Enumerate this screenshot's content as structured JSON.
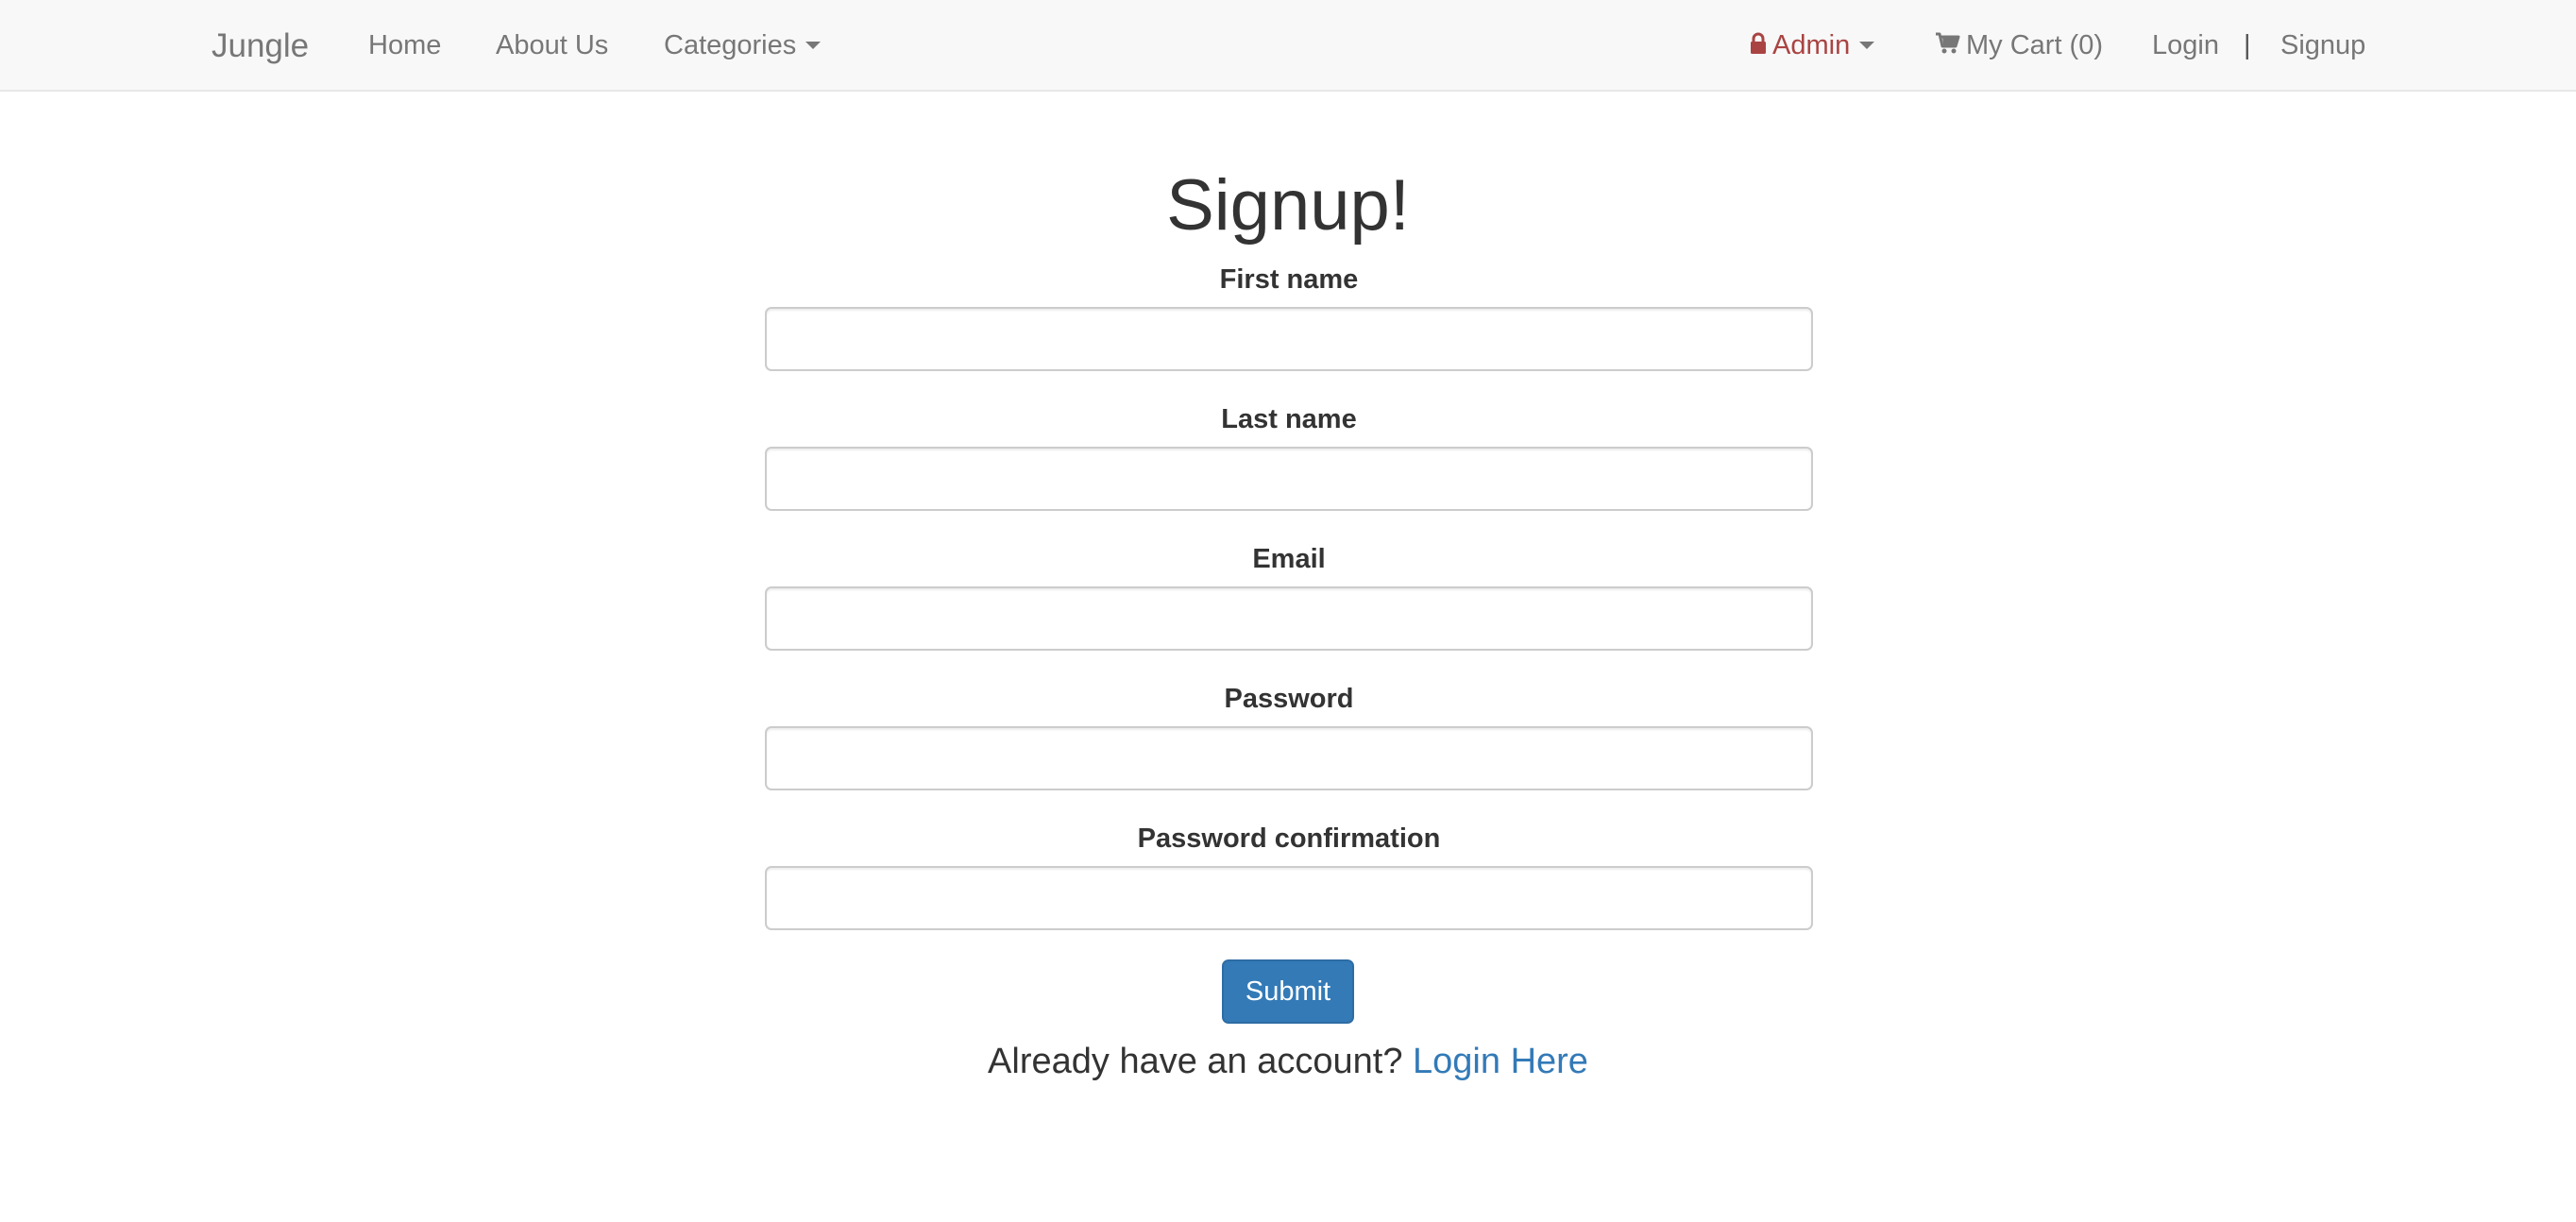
{
  "navbar": {
    "brand": "Jungle",
    "home": "Home",
    "about": "About Us",
    "categories": "Categories",
    "admin": "Admin",
    "cart": "My Cart (0)",
    "login": "Login",
    "separator": "|",
    "signup": "Signup",
    "icons": {
      "admin": "lock-icon",
      "cart": "shopping-cart-icon",
      "dropdown": "caret-down-icon"
    }
  },
  "form": {
    "title": "Signup!",
    "fields": [
      {
        "label": "First name",
        "value": ""
      },
      {
        "label": "Last name",
        "value": ""
      },
      {
        "label": "Email",
        "value": ""
      },
      {
        "label": "Password",
        "value": ""
      },
      {
        "label": "Password confirmation",
        "value": ""
      }
    ],
    "submit": "Submit"
  },
  "footer": {
    "prompt": "Already have an account?",
    "link": "Login Here"
  },
  "colors": {
    "navbar_bg": "#f8f8f8",
    "admin": "#a94442",
    "primary": "#337ab7",
    "text": "#333333",
    "nav_text": "#777777"
  }
}
